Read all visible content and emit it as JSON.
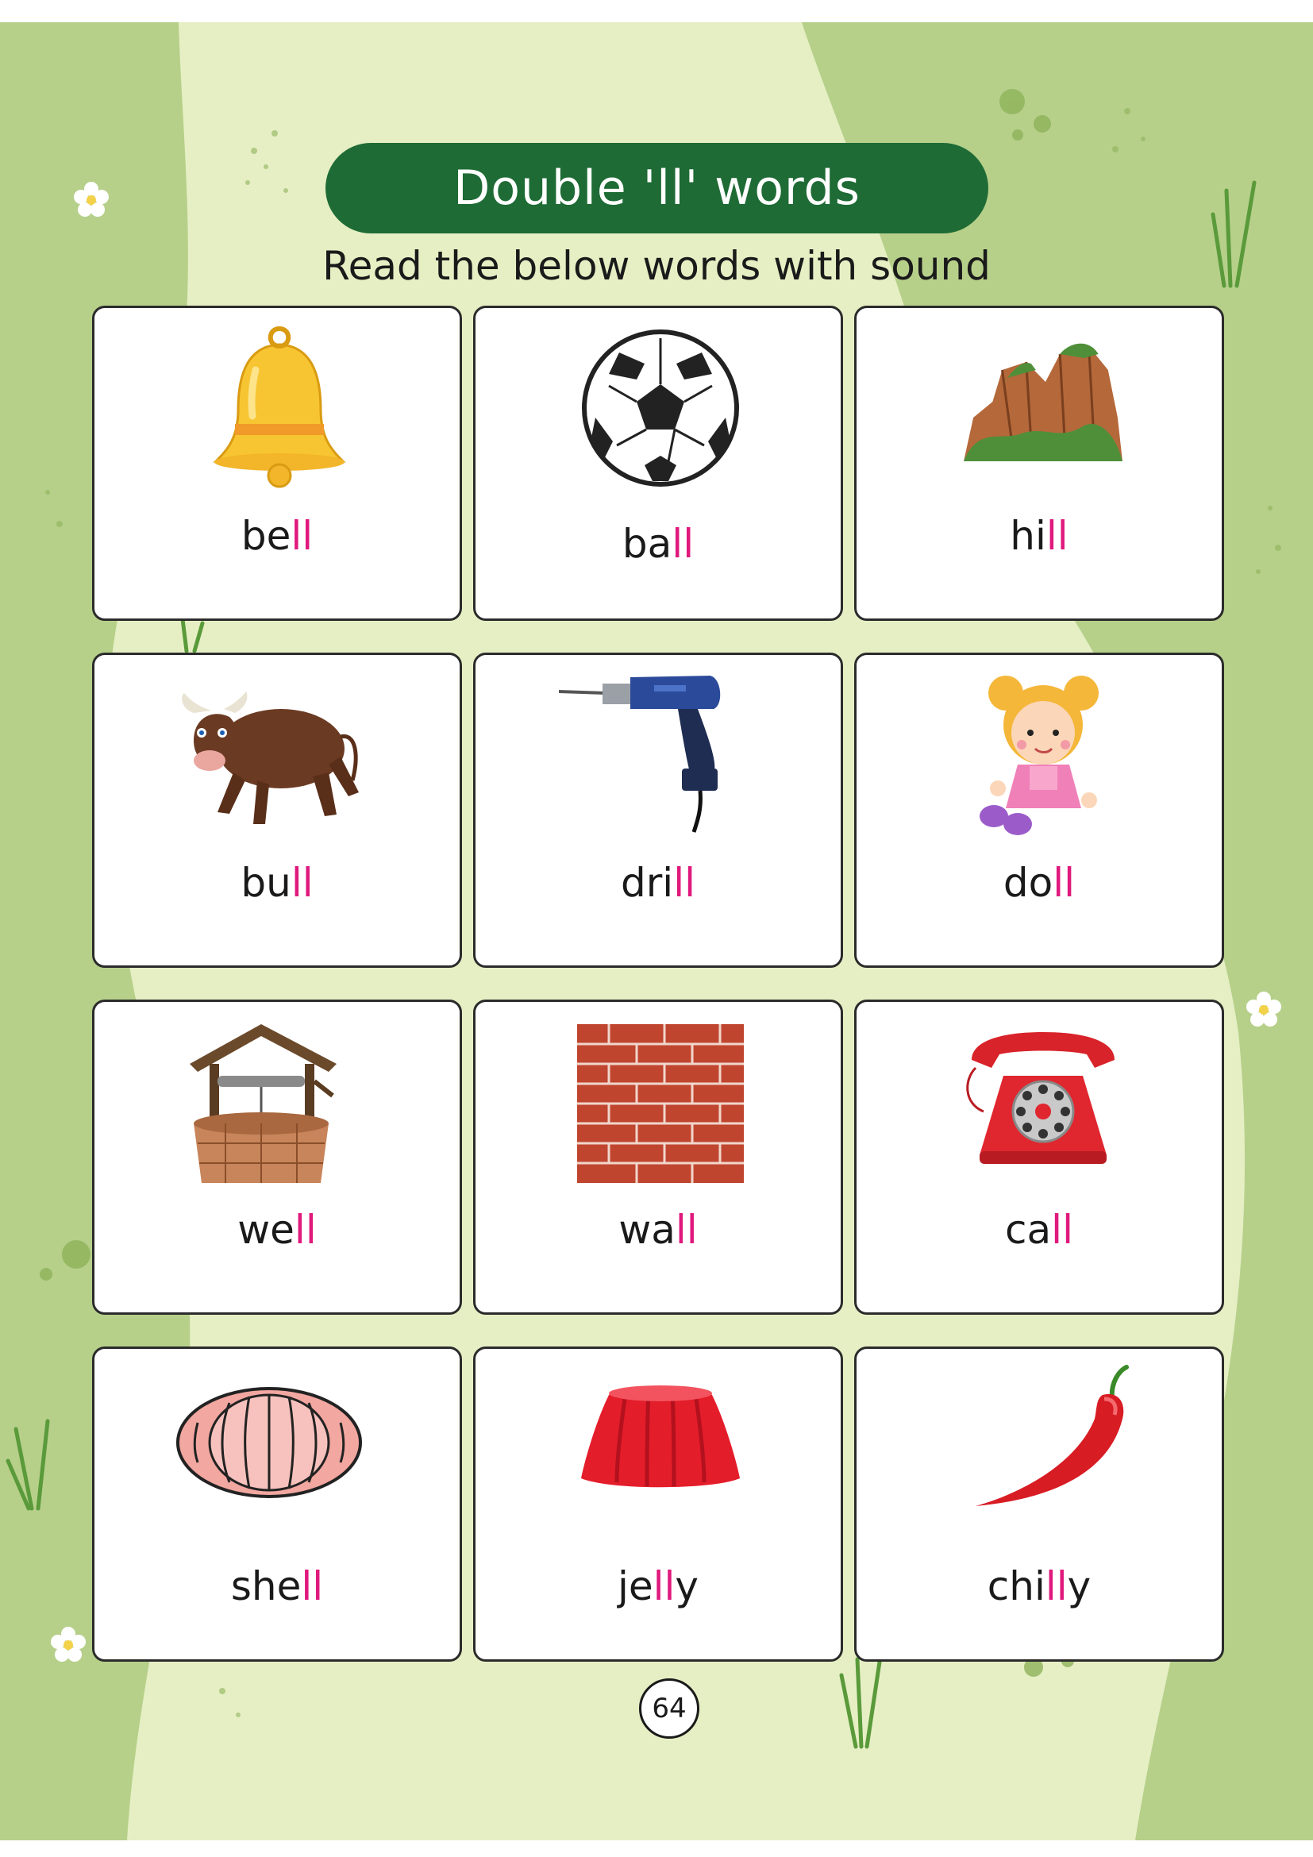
{
  "title": "Double 'll' words",
  "subtitle": "Read the below words with sound",
  "page_number": "64",
  "colors": {
    "title_bg": "#1e6b35",
    "highlight": "#e0197d",
    "background_dark": "#b6d08a",
    "background_light": "#e6efc4"
  },
  "cards": [
    {
      "prefix": "be",
      "hl": "ll",
      "suffix": "",
      "icon": "bell-icon"
    },
    {
      "prefix": "ba",
      "hl": "ll",
      "suffix": "",
      "icon": "soccer-ball-icon"
    },
    {
      "prefix": "hi",
      "hl": "ll",
      "suffix": "",
      "icon": "hill-icon"
    },
    {
      "prefix": "bu",
      "hl": "ll",
      "suffix": "",
      "icon": "bull-icon"
    },
    {
      "prefix": "dri",
      "hl": "ll",
      "suffix": "",
      "icon": "drill-icon"
    },
    {
      "prefix": "do",
      "hl": "ll",
      "suffix": "",
      "icon": "doll-icon"
    },
    {
      "prefix": "we",
      "hl": "ll",
      "suffix": "",
      "icon": "well-icon"
    },
    {
      "prefix": "wa",
      "hl": "ll",
      "suffix": "",
      "icon": "brick-wall-icon"
    },
    {
      "prefix": "ca",
      "hl": "ll",
      "suffix": "",
      "icon": "telephone-icon"
    },
    {
      "prefix": "she",
      "hl": "ll",
      "suffix": "",
      "icon": "shell-icon"
    },
    {
      "prefix": "je",
      "hl": "ll",
      "suffix": "y",
      "icon": "jelly-icon"
    },
    {
      "prefix": "chi",
      "hl": "ll",
      "suffix": "y",
      "icon": "chilli-icon"
    }
  ]
}
